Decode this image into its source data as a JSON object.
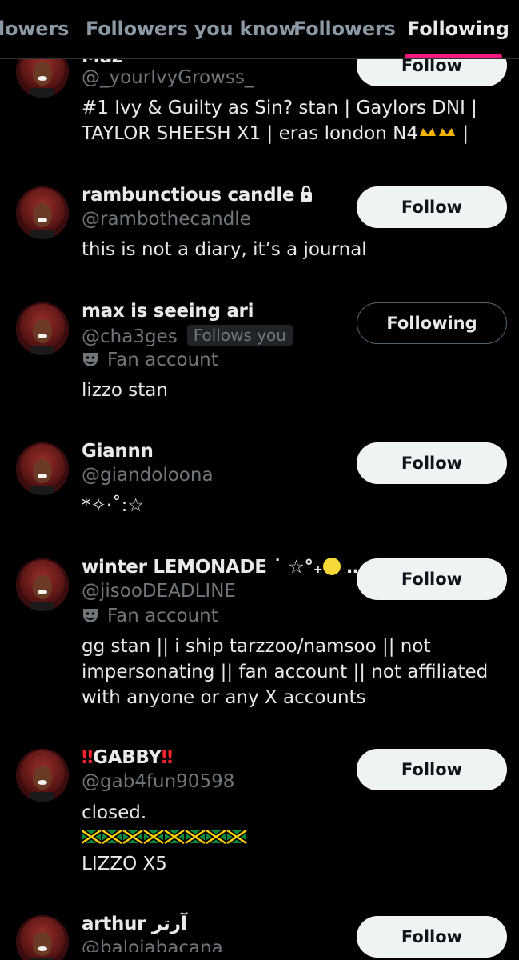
{
  "tabs": [
    {
      "label": "lowers"
    },
    {
      "label": "Followers you know"
    },
    {
      "label": "Followers"
    },
    {
      "label": "Following"
    }
  ],
  "colors": {
    "background": "#000000",
    "accent": "#f91880",
    "secondary_text": "#71767b"
  },
  "users": [
    {
      "name": "Maz",
      "handle": "@_yourIvyGrowss_",
      "bio_lines": [
        "#1 Ivy & Guilty as Sin? stan | Gaylors DNI |",
        "TAYLOR SHEESH X1 | eras london N4",
        " |"
      ],
      "button": "Follow"
    },
    {
      "name": "rambunctious candle",
      "locked": true,
      "handle": "@rambothecandle",
      "bio_lines": [
        "this is not a diary, it’s a journal"
      ],
      "button": "Follow"
    },
    {
      "name": "max is seeing ari",
      "handle": "@cha3ges",
      "follows_you": "Follows you",
      "meta": "Fan account",
      "bio_lines": [
        "lizzo stan"
      ],
      "button": "Following"
    },
    {
      "name": "Giannn",
      "handle": "@giandoloona",
      "bio_lines": [
        "*✧·˚:☆"
      ],
      "button": "Follow"
    },
    {
      "name": "winter LEMONADE ˙ ☆°₊",
      "name_suffix": " …",
      "handle": "@jisooDEADLINE",
      "meta": "Fan account",
      "bio_lines": [
        "gg stan || i ship tarzzoo/namsoo || not",
        "impersonating || fan account || not affiliated",
        "with anyone or any X accounts"
      ],
      "button": "Follow"
    },
    {
      "name_bang": "‼",
      "name": "GABBY",
      "handle": "@gab4fun90598",
      "bio_lines": [
        "closed.",
        "",
        "LIZZO X5"
      ],
      "button": "Follow"
    },
    {
      "name": "arthur آرتر",
      "handle": "@balojabacana",
      "button": "Follow"
    }
  ]
}
